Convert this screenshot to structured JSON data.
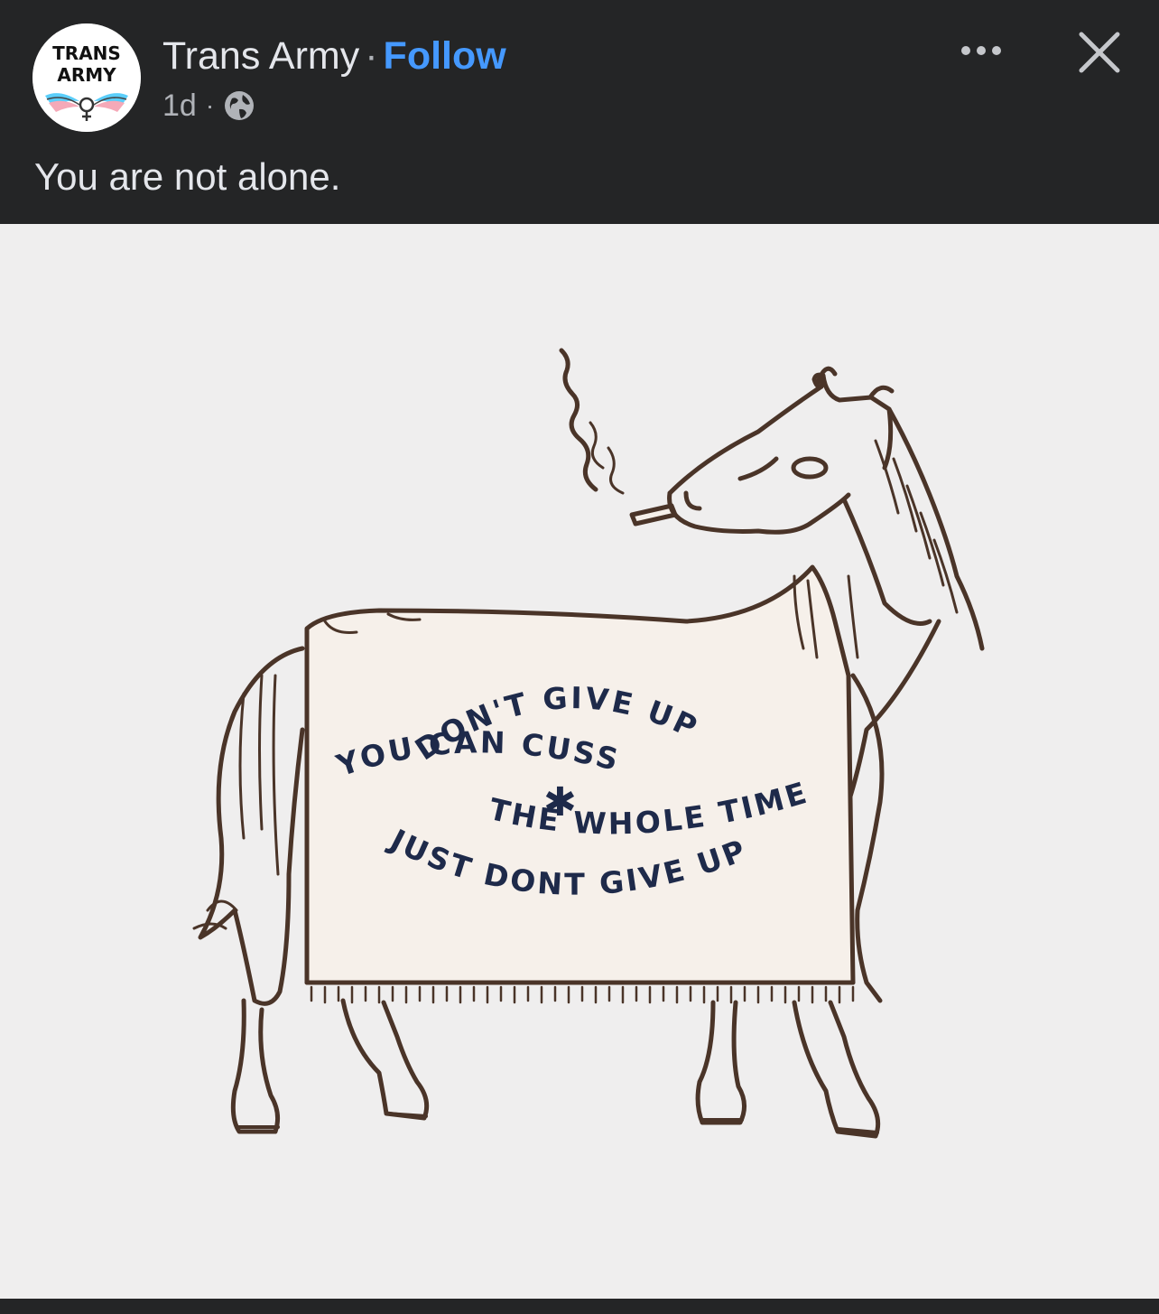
{
  "post": {
    "page_name": "Trans Army",
    "separator": "·",
    "follow_label": "Follow",
    "timestamp": "1d",
    "meta_separator": "·",
    "privacy_icon": "globe-icon",
    "caption": "You are not alone.",
    "more_icon": "more-dots-icon",
    "close_icon": "close-icon"
  },
  "avatar": {
    "logo_line1": "TRANS",
    "logo_line2": "ARMY"
  },
  "image": {
    "description_icon": "horse-illustration",
    "blanket_text": {
      "line1": "DON'T GIVE UP",
      "line2": "YOU CAN CUSS",
      "line3": "THE WHOLE TIME",
      "line4": "JUST DONT GIVE UP",
      "star": "✱"
    }
  },
  "colors": {
    "background": "#242526",
    "text_primary": "#e4e6eb",
    "text_secondary": "#b0b3b8",
    "follow_blue": "#4599ff",
    "photo_bg": "#efeeee",
    "ink": "#4a3428",
    "blanket_text": "#1e2a4a"
  }
}
